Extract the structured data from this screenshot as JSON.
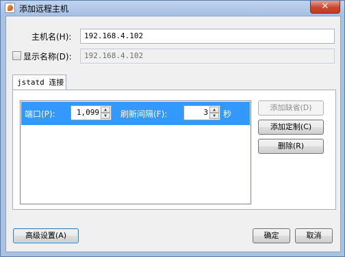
{
  "window": {
    "title": "添加远程主机",
    "close_glyph": "✕"
  },
  "host": {
    "label": "主机名(H):",
    "value": "192.168.4.102"
  },
  "display_name": {
    "label": "显示名称(D):",
    "value": "192.168.4.102",
    "checked": false
  },
  "tab": {
    "label": "jstatd 连接"
  },
  "connection": {
    "port_label": "端口(P):",
    "port_value": "1,099",
    "refresh_label": "刷新间隔(F):",
    "refresh_value": "3",
    "refresh_unit": "秒"
  },
  "side_buttons": {
    "add_default": "添加缺省(D)",
    "add_custom": "添加定制(C)",
    "delete": "删除(R)"
  },
  "footer": {
    "advanced": "高级设置(A)",
    "ok": "确定",
    "cancel": "取消"
  },
  "icons": {
    "spin_up": "▲",
    "spin_down": "▼"
  },
  "colors": {
    "selection": "#3399ff",
    "window_frame": "#a9c2e0"
  }
}
